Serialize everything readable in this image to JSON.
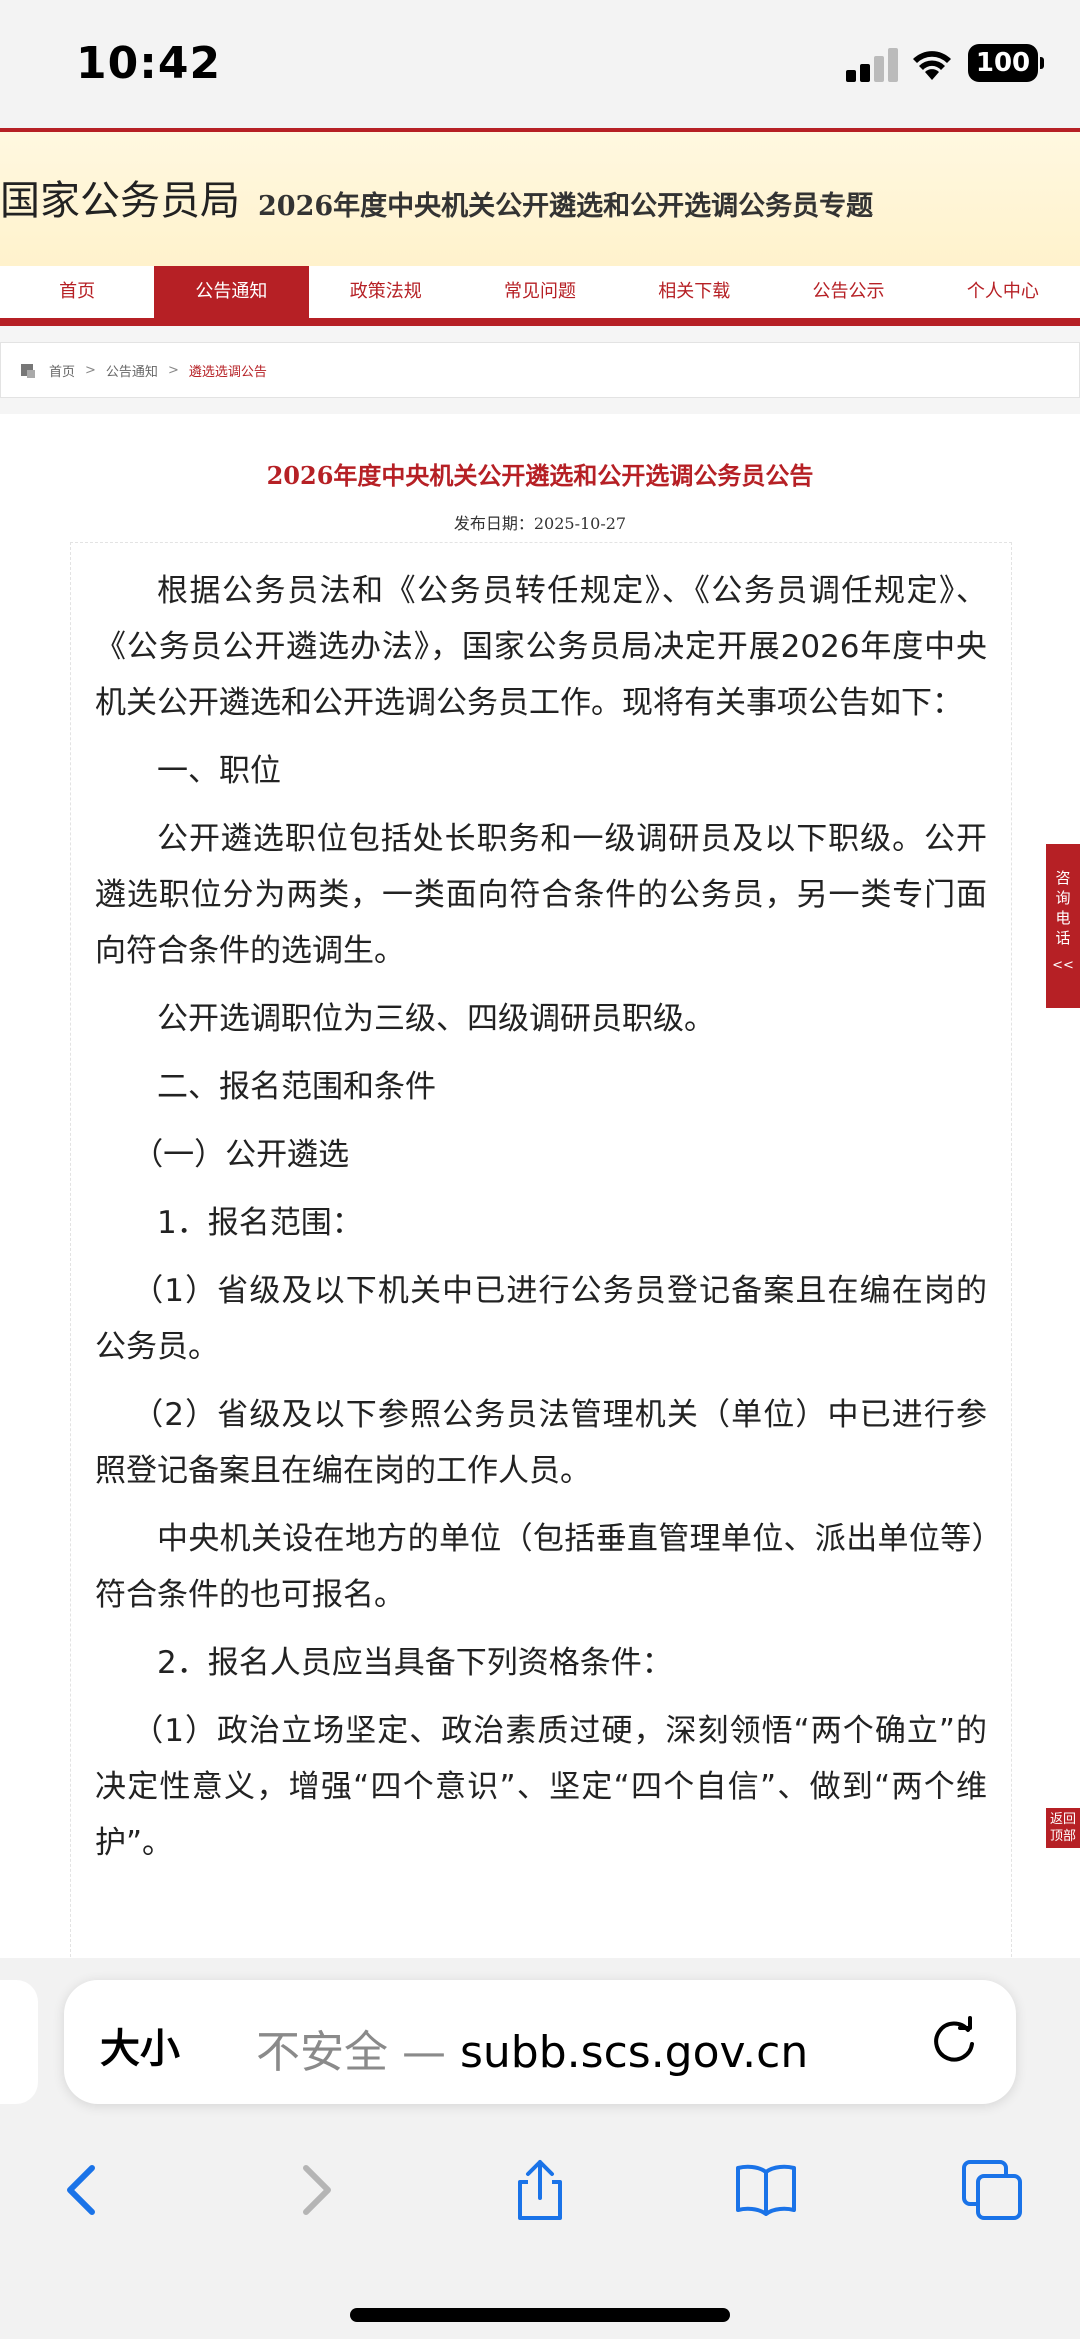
{
  "status_bar": {
    "time": "10:42",
    "battery": "100"
  },
  "site": {
    "logo": "国家公务员局",
    "title": "2026年度中央机关公开遴选和公开选调公务员专题",
    "accent_color": "#b62025",
    "nav": [
      {
        "label": "首页",
        "active": false
      },
      {
        "label": "公告通知",
        "active": true
      },
      {
        "label": "政策法规",
        "active": false
      },
      {
        "label": "常见问题",
        "active": false
      },
      {
        "label": "相关下载",
        "active": false
      },
      {
        "label": "公告公示",
        "active": false
      },
      {
        "label": "个人中心",
        "active": false
      }
    ],
    "breadcrumb": {
      "home": "首页",
      "section": "公告通知",
      "current": "遴选选调公告",
      "separator": ">"
    }
  },
  "article": {
    "title": "2026年度中央机关公开遴选和公开选调公务员公告",
    "date": "发布日期：2025-10-27",
    "paragraphs": [
      "根据公务员法和《公务员转任规定》、《公务员调任规定》、《公务员公开遴选办法》，国家公务员局决定开展2026年度中央机关公开遴选和公开选调公务员工作。现将有关事项公告如下：",
      "一、职位",
      "公开遴选职位包括处长职务和一级调研员及以下职级。公开遴选职位分为两类，一类面向符合条件的公务员，另一类专门面向符合条件的选调生。",
      "公开选调职位为三级、四级调研员职级。",
      "二、报名范围和条件",
      "（一）公开遴选",
      "1．报名范围：",
      "（1）省级及以下机关中已进行公务员登记备案且在编在岗的公务员。",
      "（2）省级及以下参照公务员法管理机关（单位）中已进行参照登记备案且在编在岗的工作人员。",
      "中央机关设在地方的单位（包括垂直管理单位、派出单位等）符合条件的也可报名。",
      "2．报名人员应当具备下列资格条件：",
      "（1）政治立场坚定、政治素质过硬，深刻领悟“两个确立”的决定性意义，增强“四个意识”、坚定“四个自信”、做到“两个维护”。"
    ],
    "side_consult": "咨询电话",
    "side_consult_arrows": "<<",
    "side_top": "返回顶部"
  },
  "browser": {
    "text_size_label": "大小",
    "insecure_label": "不安全 —",
    "url": "subb.scs.gov.cn",
    "toolbar": [
      "back-icon",
      "forward-icon",
      "share-icon",
      "bookmarks-icon",
      "tabs-icon"
    ]
  }
}
